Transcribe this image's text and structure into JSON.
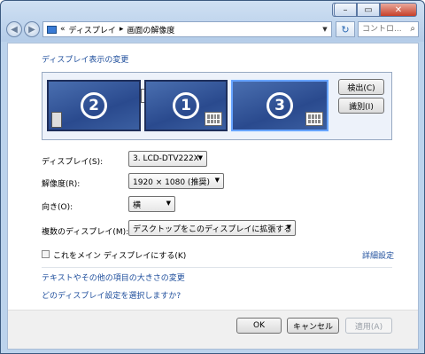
{
  "window": {
    "nav": {
      "back_icon": "back-arrow-icon",
      "forward_icon": "forward-arrow-icon"
    },
    "address": {
      "icon": "control-panel-icon",
      "overflow": "«",
      "crumbs": [
        "ディスプレイ",
        "画面の解像度"
      ],
      "separator": "▸"
    },
    "search": {
      "placeholder": "コントロ..."
    }
  },
  "section_title": "ディスプレイ表示の変更",
  "monitors": [
    {
      "number": "2"
    },
    {
      "number": "1"
    },
    {
      "number": "3",
      "selected": true
    }
  ],
  "buttons": {
    "detect": "検出(C)",
    "identify": "識別(I)",
    "ok": "OK",
    "cancel": "キャンセル",
    "apply": "適用(A)"
  },
  "fields": {
    "display_label": "ディスプレイ(S):",
    "display_value": "3. LCD-DTV222X",
    "resolution_label": "解像度(R):",
    "resolution_value": "1920 × 1080 (推奨)",
    "orientation_label": "向き(O):",
    "orientation_value": "横",
    "multi_label": "複数のディスプレイ(M):",
    "multi_value": "デスクトップをこのディスプレイに拡張する"
  },
  "main_display_checkbox": "これをメイン ディスプレイにする(K)",
  "advanced_link": "詳細設定",
  "links": {
    "text_size": "テキストやその他の項目の大きさの変更",
    "which_settings": "どのディスプレイ設定を選択しますか?"
  }
}
